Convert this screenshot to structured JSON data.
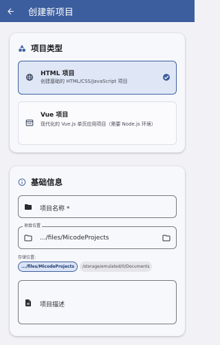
{
  "appbar": {
    "title": "创建新项目",
    "back_icon": "arrow-back-icon",
    "bg_color": "#3d5e9e"
  },
  "project_type": {
    "heading": "项目类型",
    "heading_icon": "category-shapes-icon",
    "options": [
      {
        "title": "HTML 项目",
        "description": "创建基础的 HTML/CSS/JavaScript 项目",
        "icon": "globe-icon",
        "selected": true
      },
      {
        "title": "Vue 项目",
        "description": "现代化的 Vue.js 单页应用项目（需要 Node.js 环境）",
        "icon": "web-window-icon",
        "selected": false
      }
    ]
  },
  "basic_info": {
    "heading": "基础信息",
    "heading_icon": "info-icon",
    "name_field": {
      "placeholder": "项目名称 *",
      "icon": "folder-icon"
    },
    "location_field": {
      "label": "项目位置",
      "value": ".../files/MicodeProjects",
      "icon": "folder-outline-icon",
      "trailing_icon": "folder-browse-icon"
    },
    "storage": {
      "label": "存储位置:",
      "options": [
        {
          "label": ".../files/MicodeProjects",
          "selected": true
        },
        {
          "label": "/storage/emulated/0/Documents",
          "selected": false
        }
      ]
    },
    "description_field": {
      "placeholder": "项目描述",
      "icon": "description-icon"
    }
  }
}
